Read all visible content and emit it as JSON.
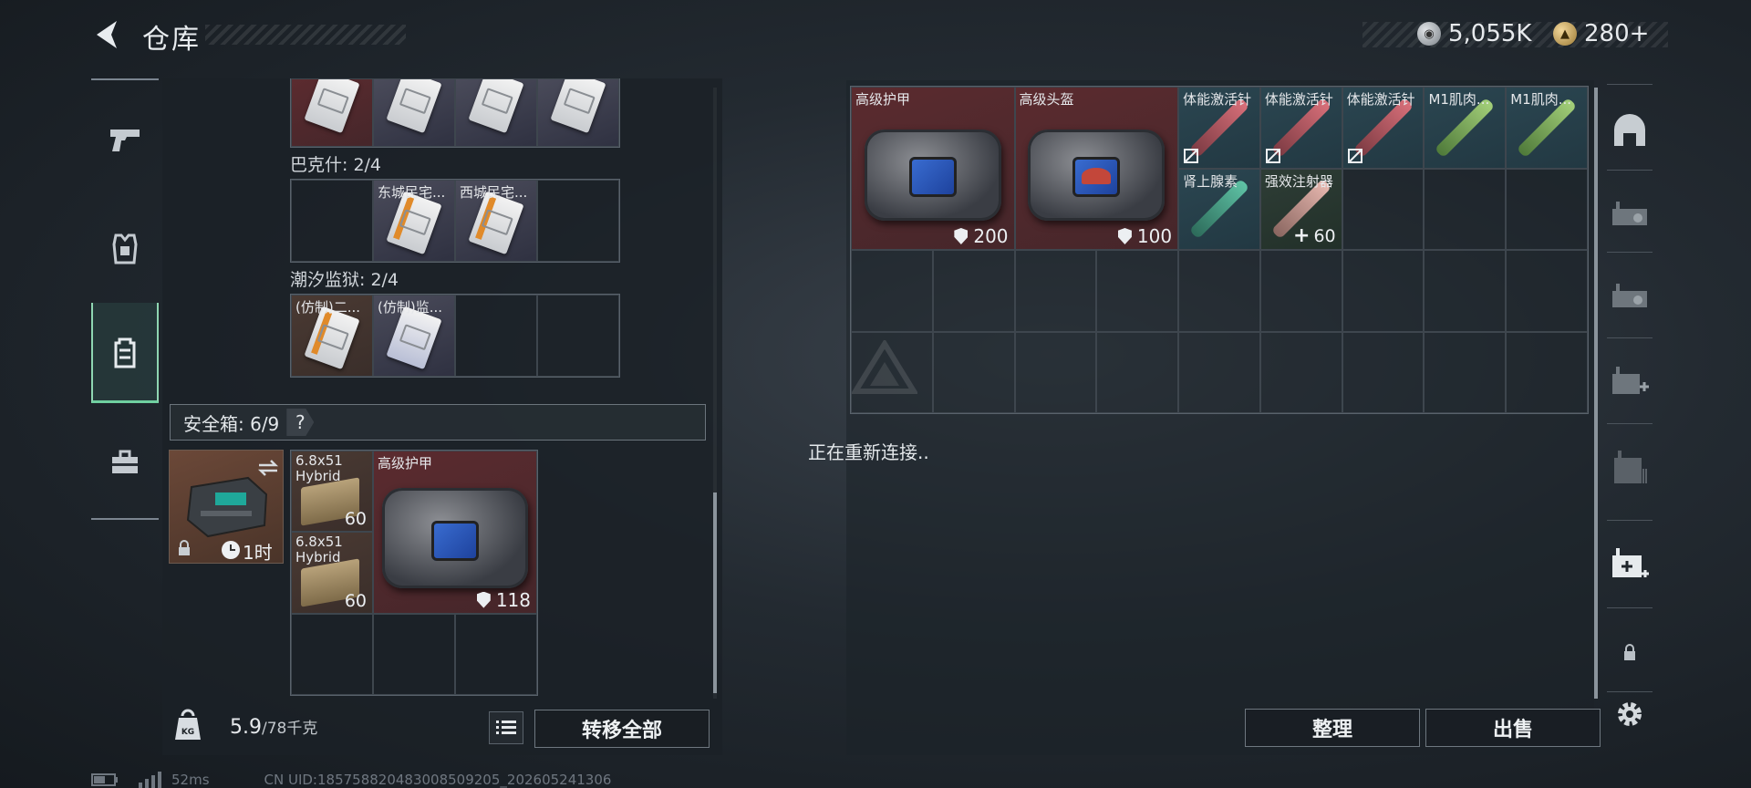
{
  "header": {
    "title": "仓库",
    "currency": [
      {
        "icon": "silver-coin-icon",
        "value": "5,055K"
      },
      {
        "icon": "gold-coin-icon",
        "value": "280+"
      }
    ]
  },
  "sidebar": {
    "tabs": [
      {
        "name": "weapons",
        "icon": "pistol-icon"
      },
      {
        "name": "equipment",
        "icon": "armor-vest-icon"
      },
      {
        "name": "backpack",
        "icon": "backpack-icon",
        "active": true
      },
      {
        "name": "supplies",
        "icon": "toolbox-icon"
      }
    ]
  },
  "left": {
    "row1_labels": [
      "",
      "",
      "",
      ""
    ],
    "section_bakshi": "巴克什: 2/4",
    "bakshi_items": [
      "",
      "东城民宅...",
      "西城民宅...",
      ""
    ],
    "section_prison": "潮汐监狱: 2/4",
    "prison_items": [
      "(仿制)二...",
      "(仿制)监...",
      "",
      ""
    ],
    "safe_box": {
      "label": "安全箱: 6/9",
      "help": "?",
      "timer": "1时"
    },
    "ammo": [
      {
        "label": "6.8x51 Hybrid",
        "count": "60"
      },
      {
        "label": "6.8x51 Hybrid",
        "count": "60"
      }
    ],
    "armor_item": {
      "label": "高级护甲",
      "durability": "118"
    },
    "weight": {
      "current": "5.9",
      "max": "/78千克"
    },
    "transfer_all": "转移全部"
  },
  "right": {
    "items": [
      {
        "label": "高级护甲",
        "value": "200",
        "kind": "armor"
      },
      {
        "label": "高级头盔",
        "value": "100",
        "kind": "helmet"
      },
      {
        "label": "体能激活针"
      },
      {
        "label": "体能激活针"
      },
      {
        "label": "体能激活针"
      },
      {
        "label": "M1肌肉..."
      },
      {
        "label": "M1肌肉..."
      },
      {
        "label": "肾上腺素"
      },
      {
        "label": "强效注射器",
        "value": "60"
      }
    ],
    "status": "正在重新连接..",
    "sort_button": "整理",
    "sell_button": "出售"
  },
  "footer": {
    "ping": "52ms",
    "uid": "CN UID:18575882048300850920​5_202605241306"
  }
}
